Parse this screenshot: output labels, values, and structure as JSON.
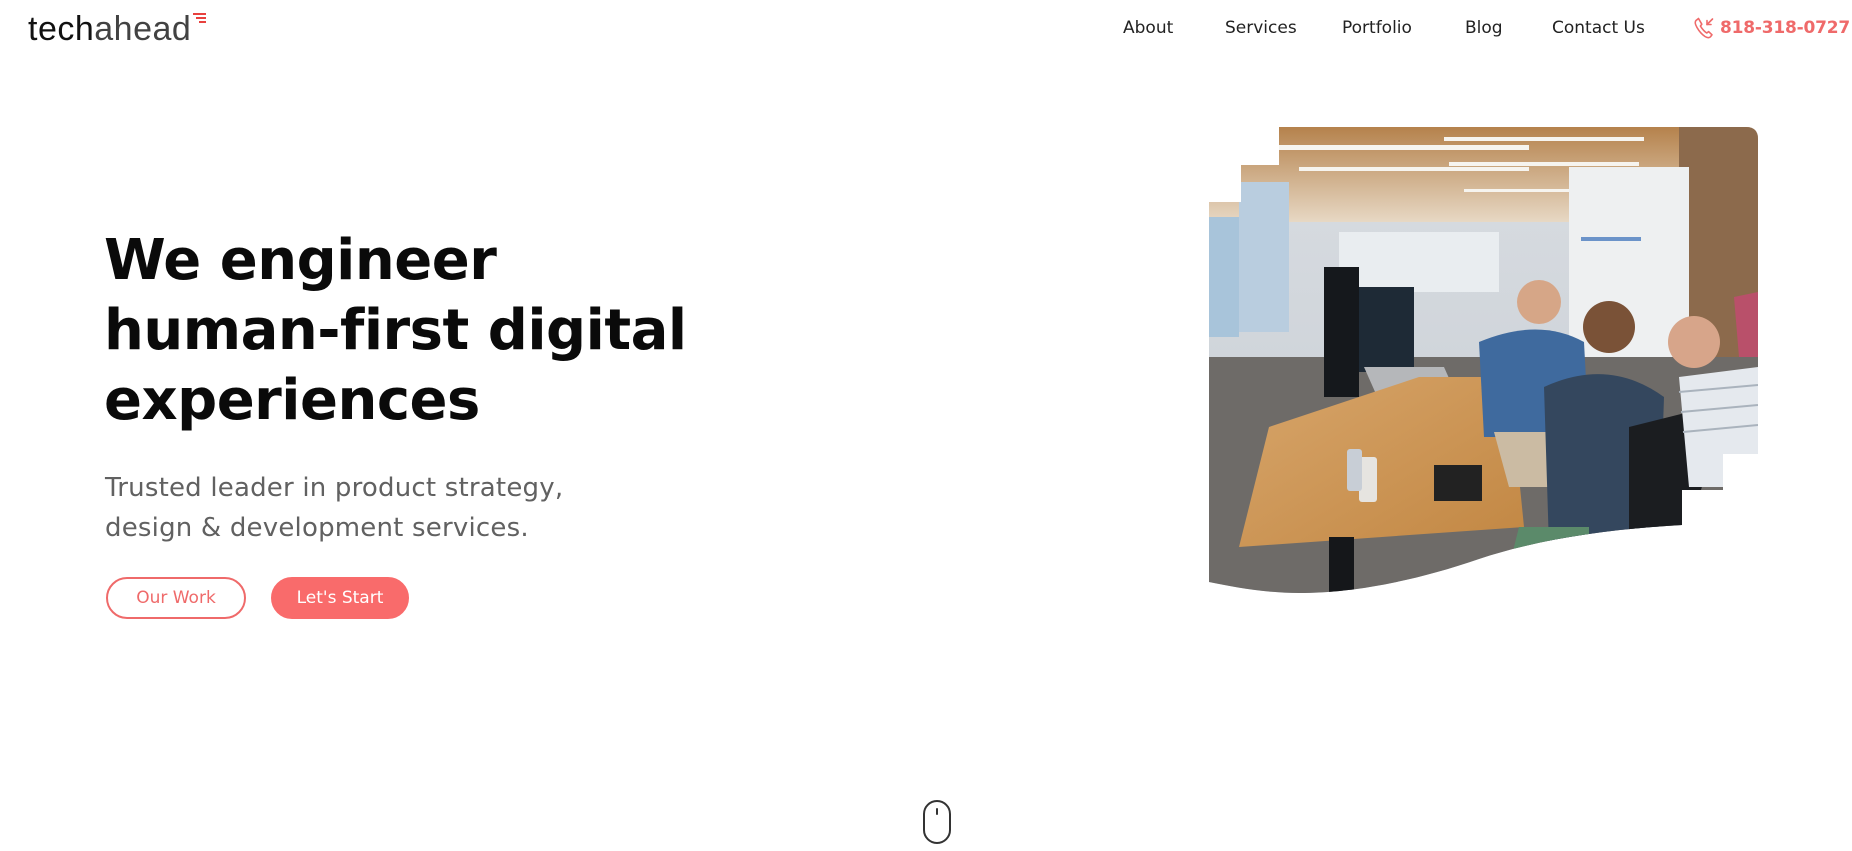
{
  "header": {
    "logo": {
      "part1": "tech",
      "part2": "ahead",
      "accent_color": "#e8413e"
    },
    "nav": [
      {
        "label": "About"
      },
      {
        "label": "Services"
      },
      {
        "label": "Portfolio"
      },
      {
        "label": "Blog"
      },
      {
        "label": "Contact Us"
      }
    ],
    "phone": {
      "icon": "phone-call-icon",
      "number": "818-318-0727",
      "color": "#ef6a6a"
    }
  },
  "hero": {
    "title_lines": [
      "We engineer",
      "human-first digital",
      "experiences"
    ],
    "subtitle_lines": [
      "Trusted leader in product strategy,",
      "design & development services."
    ],
    "buttons": {
      "our_work": "Our Work",
      "lets_start": "Let's Start"
    },
    "accent_color": "#f96b6b",
    "image": {
      "description": "Team collaborating at desks in an open-plan office"
    }
  },
  "scroll_indicator": {
    "icon": "mouse-scroll-icon"
  }
}
